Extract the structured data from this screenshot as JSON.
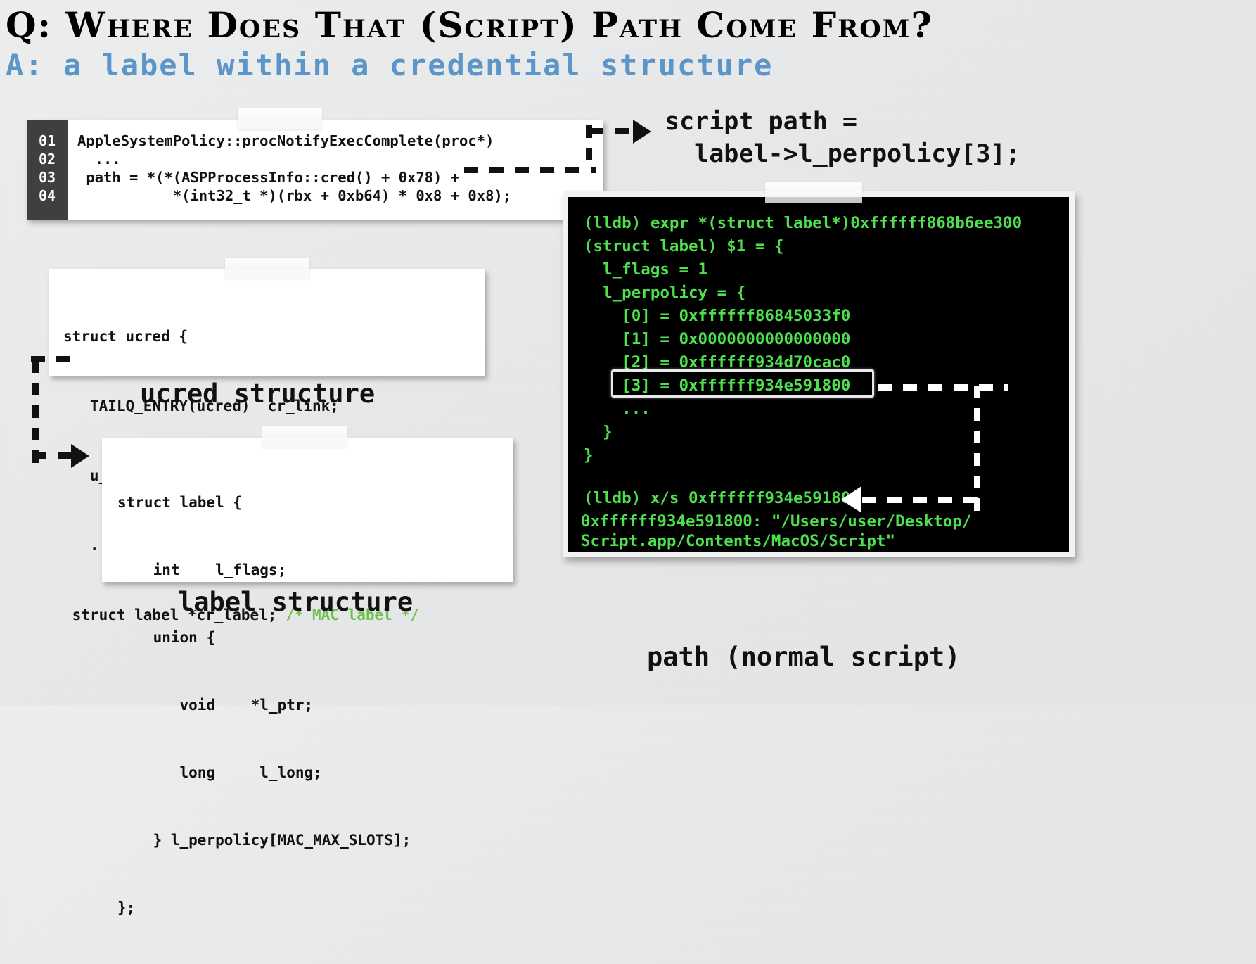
{
  "slide": {
    "question": "Q:  Where Does That (Script) Path Come From?",
    "answer": "A:  a label within a credential structure"
  },
  "decompiler_card": {
    "line_numbers": [
      "01",
      "02",
      "03",
      "04"
    ],
    "lines": [
      "AppleSystemPolicy::procNotifyExecComplete(proc*)",
      "  ...",
      " path = *(*(ASPProcessInfo::cred() + 0x78) +",
      "           *(int32_t *)(rbx + 0xb64) * 0x8 + 0x8);"
    ]
  },
  "annotation": {
    "script_path": "script path =\n  label->l_perpolicy[3];"
  },
  "ucred_card": {
    "caption": "ucred structure",
    "lines": [
      {
        "code": "struct ucred {",
        "comment": ""
      },
      {
        "code": "   TAILQ_ENTRY(ucred)  cr_link;",
        "comment": ""
      },
      {
        "code": "   u_long  cr_ref;",
        "comment": ""
      },
      {
        "code": "   ...",
        "comment": ""
      },
      {
        "code": " struct label *cr_label; ",
        "comment": "/* MAC label */"
      }
    ]
  },
  "label_card": {
    "caption": "label structure",
    "lines": [
      "struct label {",
      "    int    l_flags;",
      "    union {",
      "       void    *l_ptr;",
      "       long     l_long;",
      "    } l_perpolicy[MAC_MAX_SLOTS];",
      "};"
    ]
  },
  "terminal": {
    "caption": "path (normal script)",
    "lines": [
      "(lldb) expr *(struct label*)0xffffff868b6ee300",
      "(struct label) $1 = {",
      "  l_flags = 1",
      "  l_perpolicy = {",
      "    [0] = 0xffffff86845033f0",
      "    [1] = 0x0000000000000000",
      "    [2] = 0xffffff934d70cac0",
      "    [3] = 0xffffff934e591800",
      "    ...",
      "  }",
      "}",
      "",
      "(lldb) x/s 0xffffff934e591800",
      "0xffffff934e591800: \"/Users/user/Desktop/",
      "Script.app/Contents/MacOS/Script\""
    ],
    "highlighted_line_index": 7
  },
  "colors": {
    "background": "#e8e9ea",
    "answer_blue": "#5b95c9",
    "terminal_bg": "#000000",
    "terminal_green": "#4fe04f",
    "comment_green": "#6fc14f",
    "gutter": "#3f3f3f"
  }
}
